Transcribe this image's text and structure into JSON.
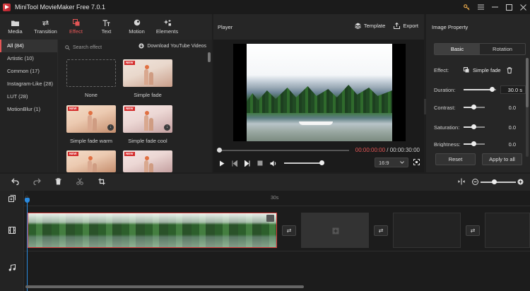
{
  "app": {
    "title": "MiniTool MovieMaker Free 7.0.1",
    "window_controls": [
      "key-icon",
      "menu-icon",
      "minimize-icon",
      "maximize-icon",
      "close-icon"
    ]
  },
  "toolbar": {
    "items": [
      {
        "label": "Media",
        "icon": "folder-icon"
      },
      {
        "label": "Transition",
        "icon": "transition-icon"
      },
      {
        "label": "Effect",
        "icon": "effect-icon",
        "active": true
      },
      {
        "label": "Text",
        "icon": "text-icon"
      },
      {
        "label": "Motion",
        "icon": "motion-icon"
      },
      {
        "label": "Elements",
        "icon": "elements-icon"
      }
    ]
  },
  "effects": {
    "categories": [
      {
        "label": "All (84)",
        "active": true
      },
      {
        "label": "Artistic (10)"
      },
      {
        "label": "Common (17)"
      },
      {
        "label": "Instagram-Like (28)"
      },
      {
        "label": "LUT (28)"
      },
      {
        "label": "MotionBlur (1)"
      }
    ],
    "search_placeholder": "Search effect",
    "download_label": "Download YouTube Videos",
    "new_badge": "NEW",
    "items": [
      {
        "label": "None"
      },
      {
        "label": "Simple fade"
      },
      {
        "label": "Simple fade warm"
      },
      {
        "label": "Simple fade cool"
      }
    ]
  },
  "player": {
    "title": "Player",
    "template_label": "Template",
    "export_label": "Export",
    "current_time": "00:00:00:00",
    "separator": "/",
    "total_time": "00:00:30:00",
    "progress": 0.0,
    "volume": 1.0,
    "aspect_ratio": "16:9"
  },
  "image_property": {
    "title": "Image Property",
    "tabs": [
      {
        "label": "Basic",
        "active": true
      },
      {
        "label": "Rotation"
      }
    ],
    "effect_label": "Effect:",
    "effect_value": "Simple fade",
    "duration_label": "Duration:",
    "duration_value": "30.0 s",
    "contrast_label": "Contrast:",
    "contrast_value": "0.0",
    "saturation_label": "Saturation:",
    "saturation_value": "0.0",
    "brightness_label": "Brightness:",
    "brightness_value": "0.0",
    "reset_label": "Reset",
    "apply_label": "Apply to all"
  },
  "timeline": {
    "ruler_labels": [
      "0",
      "30s"
    ],
    "tools": [
      "undo-icon",
      "redo-icon",
      "delete-icon",
      "split-icon",
      "crop-icon"
    ],
    "zoom_level": 0.35
  }
}
